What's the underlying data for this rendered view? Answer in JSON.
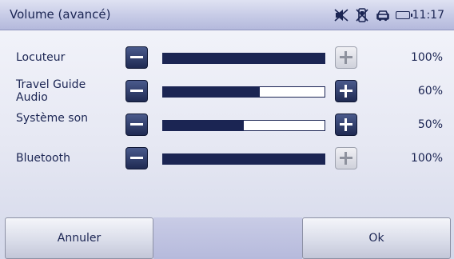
{
  "header": {
    "title": "Volume (avancé)",
    "time": "11:17",
    "status_icons": [
      "speaker-muted-icon",
      "phone-disabled-icon",
      "car-icon",
      "battery-icon"
    ]
  },
  "rows": [
    {
      "label": "Locuteur",
      "value_text": "100%",
      "value": 100,
      "plus_enabled": false
    },
    {
      "label": "Travel Guide Audio",
      "value_text": "60%",
      "value": 60,
      "plus_enabled": true
    },
    {
      "label": "Système son",
      "value_text": "50%",
      "value": 50,
      "plus_enabled": true
    },
    {
      "label": "Bluetooth",
      "value_text": "100%",
      "value": 100,
      "plus_enabled": false
    }
  ],
  "footer": {
    "cancel_label": "Annuler",
    "ok_label": "Ok"
  },
  "colors": {
    "accent": "#1b2553",
    "titlebar": "#c6cae6",
    "background": "#e6e8f3"
  }
}
